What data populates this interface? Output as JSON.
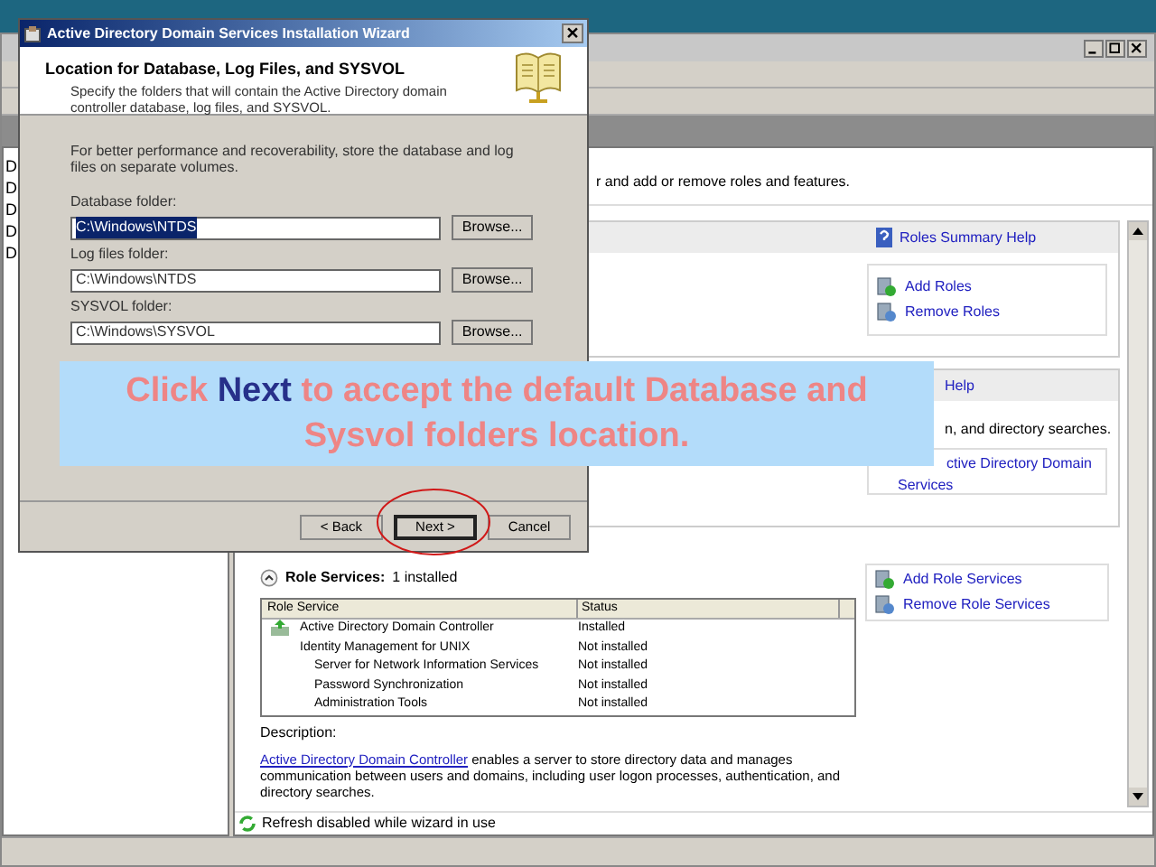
{
  "server_manager": {
    "tree_items": [
      "D",
      "D",
      "D",
      "D",
      "D"
    ],
    "intro": "r and add or remove roles and features.",
    "roles_panel": {
      "help_link": "Roles Summary Help",
      "actions": [
        "Add Roles",
        "Remove Roles"
      ]
    },
    "ad_panel": {
      "help_link": "Help",
      "summary": "n, and directory searches.",
      "link_lines": [
        "ctive Directory Domain",
        "Services"
      ]
    },
    "role_services": {
      "title": "Role Services:",
      "count": "1 installed",
      "expanded": true,
      "columns": [
        "Role Service",
        "Status"
      ],
      "rows": [
        {
          "name": "Active Directory Domain Controller",
          "status": "Installed",
          "installed": true
        },
        {
          "name": "Identity Management for UNIX",
          "status": "Not installed",
          "installed": false,
          "children": [
            {
              "name": "Server for Network Information Services",
              "status": "Not installed",
              "installed": false
            },
            {
              "name": "Password Synchronization",
              "status": "Not installed",
              "installed": false
            },
            {
              "name": "Administration Tools",
              "status": "Not installed",
              "installed": false
            }
          ]
        }
      ],
      "description_label": "Description:",
      "description_link": "Active Directory Domain Controller",
      "description_text": " enables a server to store directory data and manages communication between users and domains, including user logon processes, authentication, and directory searches.",
      "actions": [
        "Add Role Services",
        "Remove Role Services"
      ]
    },
    "refresh_status": "Refresh disabled while wizard in use"
  },
  "wizard": {
    "title": "Active Directory Domain Services Installation Wizard",
    "heading": "Location for Database, Log Files, and SYSVOL",
    "subtitle": "Specify the folders that will contain the Active Directory domain controller database, log files, and SYSVOL.",
    "intro": "For better performance and recoverability, store the database and log files on separate volumes.",
    "fields": [
      {
        "label": "Database folder:",
        "value": "C:\\Windows\\NTDS",
        "selected": true,
        "browse": "Browse..."
      },
      {
        "label": "Log files folder:",
        "value": "C:\\Windows\\NTDS",
        "selected": false,
        "browse": "Browse..."
      },
      {
        "label": "SYSVOL folder:",
        "value": "C:\\Windows\\SYSVOL",
        "selected": false,
        "browse": "Browse..."
      }
    ],
    "buttons": [
      {
        "label": "< Back",
        "focused": false
      },
      {
        "label": "Next >",
        "focused": true
      },
      {
        "label": "Cancel",
        "focused": false
      }
    ]
  },
  "callout": {
    "parts": [
      {
        "text": "Click ",
        "kind": "plain"
      },
      {
        "text": "Next",
        "kind": "emphasis"
      },
      {
        "text": " to accept the default Database and Sysvol folders location.",
        "kind": "plain"
      }
    ]
  }
}
